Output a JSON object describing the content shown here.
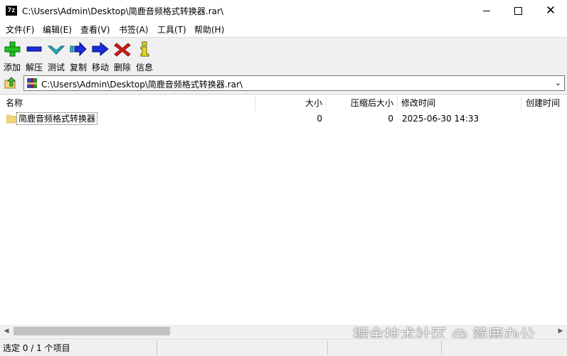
{
  "window": {
    "title": "C:\\Users\\Admin\\Desktop\\简鹿音频格式转换器.rar\\",
    "app_icon_text": "7z"
  },
  "menu": [
    "文件(F)",
    "编辑(E)",
    "查看(V)",
    "书签(A)",
    "工具(T)",
    "帮助(H)"
  ],
  "toolbar": {
    "add": "添加",
    "extract": "解压",
    "test": "测试",
    "copy": "复制",
    "move": "移动",
    "delete": "删除",
    "info": "信息"
  },
  "address": {
    "path": "C:\\Users\\Admin\\Desktop\\简鹿音频格式转换器.rar\\"
  },
  "list": {
    "columns": [
      "名称",
      "大小",
      "压缩后大小",
      "修改时间",
      "创建时间"
    ],
    "rows": [
      {
        "name": "简鹿音频格式转换器",
        "size": "0",
        "packed": "0",
        "modified": "2025-06-30 14:33",
        "created": ""
      }
    ]
  },
  "status": {
    "selection": "选定 0 / 1 个项目"
  },
  "watermark": "掘金技术社区 @ 简鹿办公",
  "colors": {
    "add": "#1ec01e",
    "extract": "#1a2bd8",
    "test": "#1fb8c8",
    "move": "#1a2bd8",
    "delete": "#e01818",
    "info": "#e8d820",
    "folder": "#f5d57a"
  }
}
